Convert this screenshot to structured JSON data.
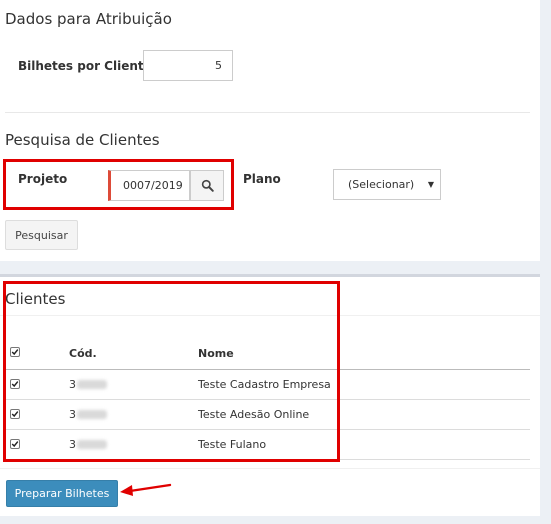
{
  "atribuicao": {
    "title": "Dados para Atribuição",
    "bilhetes_label": "Bilhetes por Cliente",
    "bilhetes_value": "5"
  },
  "pesquisa": {
    "title": "Pesquisa de Clientes",
    "projeto_label": "Projeto",
    "projeto_value": "0007/2019",
    "plano_label": "Plano",
    "plano_value": "(Selecionar)",
    "pesquisar_button": "Pesquisar"
  },
  "clientes": {
    "title": "Clientes",
    "columns": [
      "Cód.",
      "Nome"
    ],
    "rows": [
      {
        "cod": "3",
        "nome": "Teste Cadastro Empresa",
        "checked": true
      },
      {
        "cod": "3",
        "nome": "Teste Adesão Online",
        "checked": true
      },
      {
        "cod": "3",
        "nome": "Teste Fulano",
        "checked": true
      }
    ],
    "select_all_checked": true
  },
  "footer": {
    "preparar_button": "Preparar Bilhetes"
  },
  "colors": {
    "primary": "#3c8dbc",
    "highlight": "#e00000",
    "background": "#ecf0f5"
  }
}
